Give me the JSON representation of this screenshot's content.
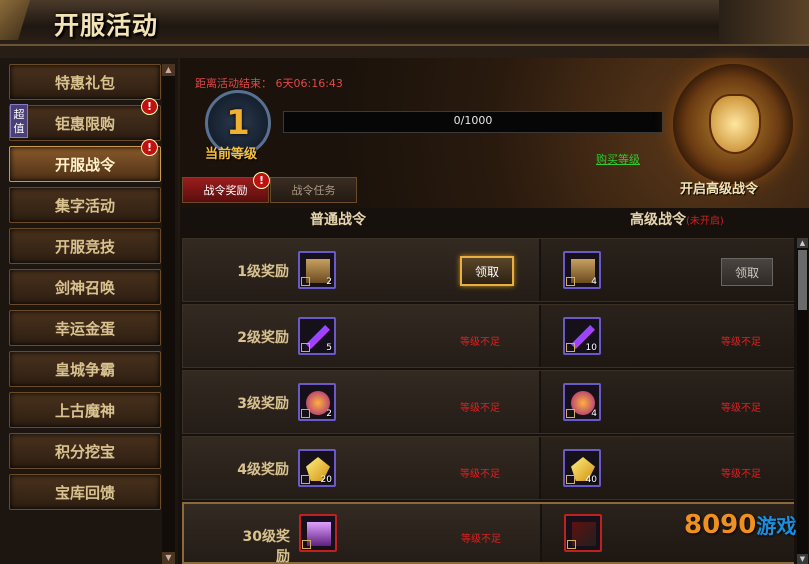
{
  "window": {
    "title": "开服活动"
  },
  "sidebar": {
    "super_tag": "超值",
    "items": [
      {
        "label": "特惠礼包",
        "badge": ""
      },
      {
        "label": "钜惠限购",
        "badge": "!"
      },
      {
        "label": "开服战令",
        "badge": "!"
      },
      {
        "label": "集字活动",
        "badge": ""
      },
      {
        "label": "开服竞技",
        "badge": ""
      },
      {
        "label": "剑神召唤",
        "badge": ""
      },
      {
        "label": "幸运金蛋",
        "badge": ""
      },
      {
        "label": "皇城争霸",
        "badge": ""
      },
      {
        "label": "上古魔神",
        "badge": ""
      },
      {
        "label": "积分挖宝",
        "badge": ""
      },
      {
        "label": "宝库回馈",
        "badge": ""
      }
    ],
    "active_index": 2
  },
  "header": {
    "countdown_label": "距离活动结束：",
    "countdown_value": "6天06:16:43",
    "level": "1",
    "level_label": "当前等级",
    "progress_text": "0/1000",
    "progress_fraction": 0,
    "buy_level": "购买等级",
    "advanced_unlock": "开启高级战令"
  },
  "tabs": [
    {
      "label": "战令奖励",
      "badge": "!"
    },
    {
      "label": "战令任务"
    }
  ],
  "columns": {
    "normal": "普通战令",
    "advanced": "高级战令",
    "advanced_status": "(未开启)"
  },
  "rows": [
    {
      "label": "1级奖励",
      "normal_count": "2",
      "normal_icon": "treasure-chest-icon",
      "normal_action": "领取",
      "adv_count": "4",
      "adv_icon": "treasure-chest-icon",
      "adv_action": "领取"
    },
    {
      "label": "2级奖励",
      "normal_count": "5",
      "normal_icon": "feather-icon",
      "normal_action": "等级不足",
      "adv_count": "10",
      "adv_icon": "feather-icon",
      "adv_action": "等级不足"
    },
    {
      "label": "3级奖励",
      "normal_count": "2",
      "normal_icon": "orb-icon",
      "normal_action": "等级不足",
      "adv_count": "4",
      "adv_icon": "orb-icon",
      "adv_action": "等级不足"
    },
    {
      "label": "4级奖励",
      "normal_count": "20",
      "normal_icon": "yellow-crystal-icon",
      "normal_action": "等级不足",
      "adv_count": "40",
      "adv_icon": "yellow-crystal-icon",
      "adv_action": "等级不足"
    },
    {
      "label": "30级奖励",
      "normal_count": "",
      "normal_icon": "purple-chest-icon",
      "normal_action": "等级不足",
      "adv_count": "",
      "adv_icon": "weapon-icon",
      "adv_action": ""
    }
  ],
  "logo": {
    "text": "8090",
    "suffix": "游戏"
  },
  "colors": {
    "accent_gold": "#e8b040",
    "warning_red": "#e02020",
    "link_green": "#2ecc2e"
  }
}
